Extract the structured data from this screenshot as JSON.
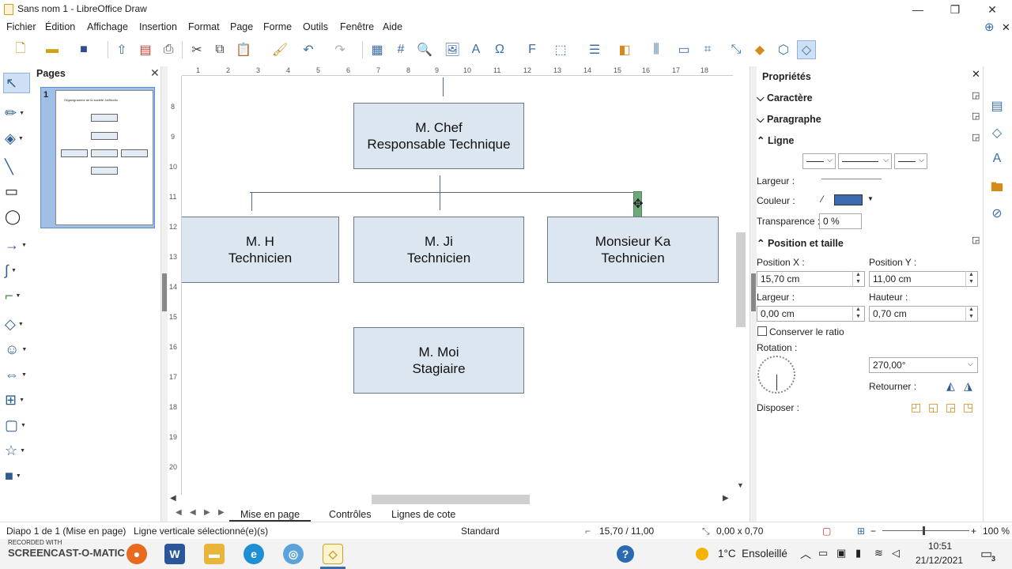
{
  "window": {
    "title": "Sans nom 1 - LibreOffice Draw",
    "minimize": "—",
    "restore": "❐",
    "close": "✕"
  },
  "menu": [
    "Fichier",
    "Édition",
    "Affichage",
    "Insertion",
    "Format",
    "Page",
    "Forme",
    "Outils",
    "Fenêtre",
    "Aide"
  ],
  "pages_panel": {
    "title": "Pages",
    "page_number": "1",
    "thumb_title": "Organigramme de la société JalStudio"
  },
  "ruler": {
    "h": [
      "1",
      "2",
      "3",
      "4",
      "5",
      "6",
      "7",
      "8",
      "9",
      "10",
      "11",
      "12",
      "13",
      "14",
      "15",
      "16",
      "17",
      "18"
    ],
    "v": [
      "8",
      "9",
      "10",
      "11",
      "12",
      "13",
      "14",
      "15",
      "16",
      "17",
      "18",
      "19",
      "20"
    ]
  },
  "shapes": {
    "chef": {
      "name": "M. Chef",
      "role": "Responsable Technique"
    },
    "h": {
      "name": "M. H",
      "role": "Technicien"
    },
    "ji": {
      "name": "M. Ji",
      "role": "Technicien"
    },
    "ka": {
      "name": "Monsieur Ka",
      "role": "Technicien"
    },
    "moi": {
      "name": "M. Moi",
      "role": "Stagiaire"
    }
  },
  "tabs": [
    "Mise en page",
    "Contrôles",
    "Lignes de cote"
  ],
  "sidebar": {
    "title": "Propriétés",
    "caractere": "Caractère",
    "paragraphe": "Paragraphe",
    "ligne": "Ligne",
    "largeur": "Largeur :",
    "couleur": "Couleur :",
    "color_value": "#3c6ab0",
    "transparence": "Transparence :",
    "transparence_value": "0 %",
    "position_taille": "Position et taille",
    "pos_x_label": "Position X :",
    "pos_y_label": "Position Y :",
    "pos_x": "15,70 cm",
    "pos_y": "11,00 cm",
    "largeur_label": "Largeur :",
    "hauteur_label": "Hauteur :",
    "largeur_value": "0,00 cm",
    "hauteur_value": "0,70 cm",
    "ratio": "Conserver le ratio",
    "rotation_label": "Rotation :",
    "rotation_value": "270,00°",
    "retourner": "Retourner :",
    "disposer": "Disposer :"
  },
  "status": {
    "slide": "Diapo 1 de 1 (Mise en page)",
    "selection": "Ligne verticale sélectionné(e)(s)",
    "style": "Standard",
    "position": "15,70 / 11,00",
    "size": "0,00 x 0,70",
    "zoom": "100 %"
  },
  "taskbar": {
    "weather": "1°C  Ensoleillé",
    "time": "10:51",
    "date": "21/12/2021",
    "notif": "3",
    "watermark_top": "RECORDED WITH",
    "watermark": "SCREENCAST-O-MATIC"
  }
}
